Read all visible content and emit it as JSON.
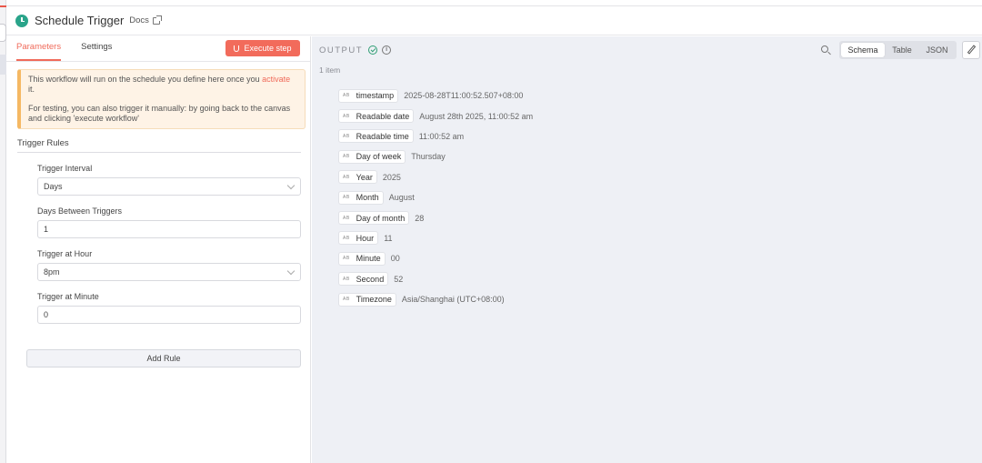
{
  "node": {
    "title": "Schedule Trigger",
    "docs_label": "Docs"
  },
  "tabs": [
    {
      "label": "Parameters",
      "active": true
    },
    {
      "label": "Settings",
      "active": false
    }
  ],
  "execute_label": "Execute step",
  "notice": {
    "line1_pre": "This workflow will run on the schedule you define here once you ",
    "line1_link": "activate",
    "line1_post": " it.",
    "line2": "For testing, you can also trigger it manually: by going back to the canvas and clicking 'execute workflow'"
  },
  "rules": {
    "title": "Trigger Rules",
    "fields": [
      {
        "label": "Trigger Interval",
        "value": "Days",
        "type": "select"
      },
      {
        "label": "Days Between Triggers",
        "value": "1",
        "type": "input"
      },
      {
        "label": "Trigger at Hour",
        "value": "8pm",
        "type": "select"
      },
      {
        "label": "Trigger at Minute",
        "value": "0",
        "type": "input"
      }
    ],
    "add_rule_label": "Add Rule"
  },
  "output": {
    "title": "OUTPUT",
    "item_count": "1 item",
    "views": [
      "Schema",
      "Table",
      "JSON"
    ],
    "active_view": "Schema",
    "type_badge": "AB",
    "rows": [
      {
        "key": "timestamp",
        "value": "2025-08-28T11:00:52.507+08:00"
      },
      {
        "key": "Readable date",
        "value": "August 28th 2025, 11:00:52 am"
      },
      {
        "key": "Readable time",
        "value": "11:00:52 am"
      },
      {
        "key": "Day of week",
        "value": "Thursday"
      },
      {
        "key": "Year",
        "value": "2025"
      },
      {
        "key": "Month",
        "value": "August"
      },
      {
        "key": "Day of month",
        "value": "28"
      },
      {
        "key": "Hour",
        "value": "11"
      },
      {
        "key": "Minute",
        "value": "00"
      },
      {
        "key": "Second",
        "value": "52"
      },
      {
        "key": "Timezone",
        "value": "Asia/Shanghai (UTC+08:00)"
      }
    ]
  },
  "colors": {
    "accent": "#f06a5a",
    "node_icon": "#2aa48a",
    "success": "#2f9e74"
  }
}
